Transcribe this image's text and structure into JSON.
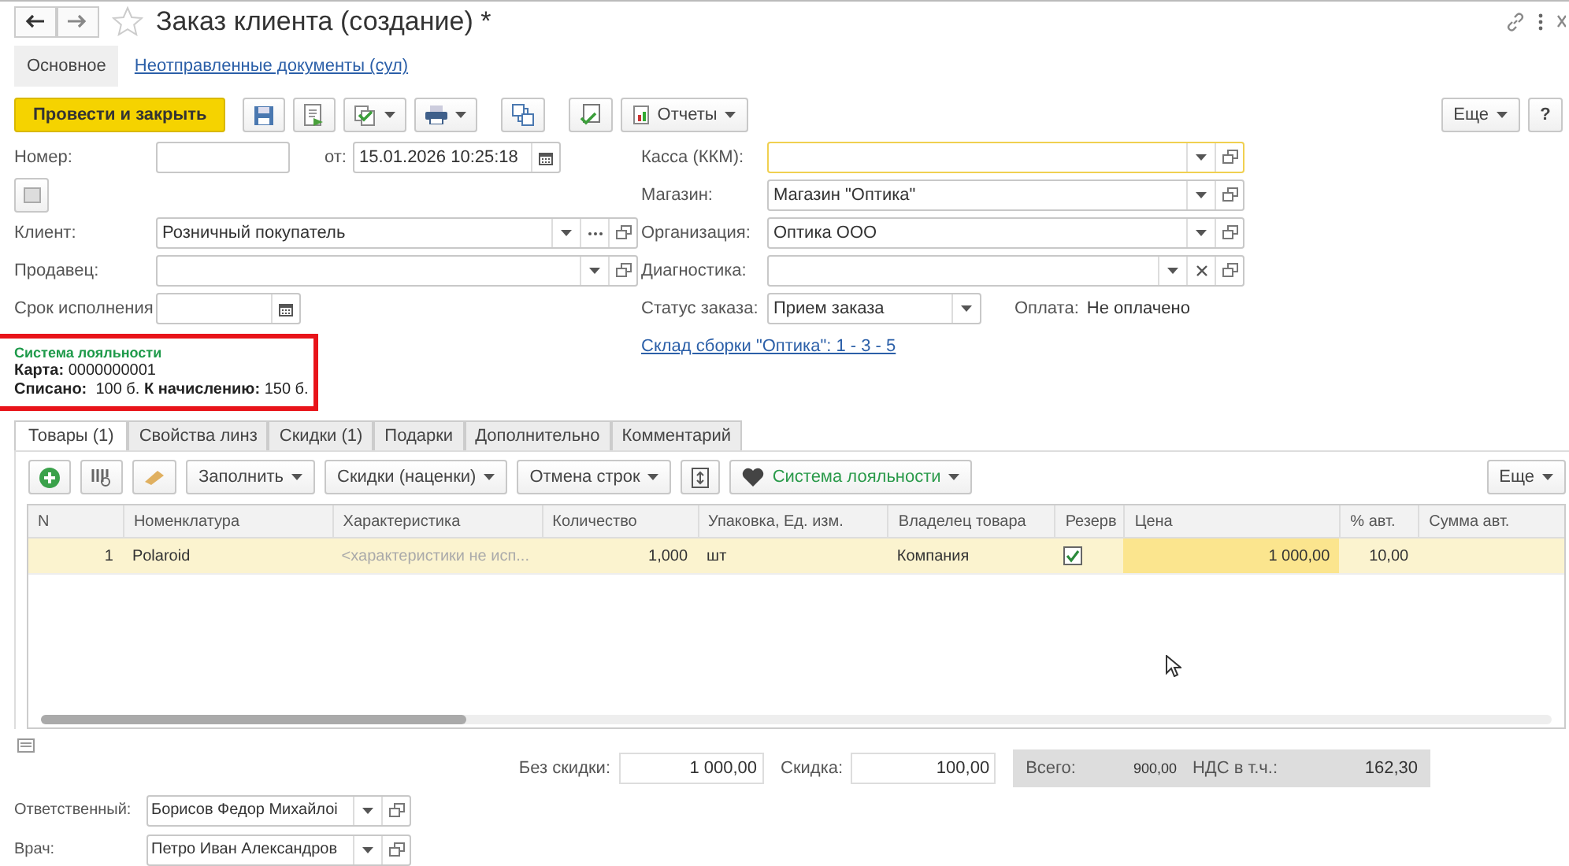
{
  "window": {
    "title": "Заказ клиента (создание) *",
    "favorite": false
  },
  "sections": [
    {
      "label": "Основное",
      "selected": true
    },
    {
      "label": "Неотправленные документы (сул)",
      "selected": false
    }
  ],
  "toolbar": {
    "primary": "Провести и закрыть",
    "reports": "Отчеты",
    "more": "Еще",
    "help": "?"
  },
  "left_fields": [
    {
      "label": "Номер:",
      "kind": "plain",
      "focused": false
    },
    {
      "label": "от:",
      "value": "15.01.2026 10:25:18",
      "kind": "date",
      "focused": false
    },
    {
      "label": "Клиент:",
      "value": "Розничный покупатель",
      "kind": "ref_select",
      "focused": false
    },
    {
      "label": "Продавец:",
      "kind": "ref",
      "focused": false
    },
    {
      "label": "Срок исполнения",
      "kind": "date",
      "focused": false
    }
  ],
  "right_fields": [
    {
      "label": "Касса (ККМ):",
      "kind": "ref",
      "focused": true
    },
    {
      "label": "Магазин:",
      "value": "Магазин \"Оптика\"",
      "kind": "ref",
      "focused": false
    },
    {
      "label": "Организация:",
      "value": "Оптика ООО",
      "kind": "ref",
      "focused": false
    },
    {
      "label": "Диагностика:",
      "kind": "ref_clear",
      "focused": false
    },
    {
      "label": "Статус заказа:",
      "value": "Прием заказа",
      "kind": "combo",
      "focused": false
    }
  ],
  "payment": {
    "label": "Оплата:",
    "value": "Не оплачено"
  },
  "warehouse_link": "Склад сборки \"Оптика\": 1 - 3 - 5",
  "loyalty": {
    "title": "Система лояльности",
    "lines": [
      "**Карта:** 0000000001",
      "**Списано:**  100 б. **К начислению:** 150 б."
    ]
  },
  "tabs": [
    {
      "label": "Товары (1)",
      "selected": true
    },
    {
      "label": "Свойства линз",
      "selected": false
    },
    {
      "label": "Скидки (1)",
      "selected": false
    },
    {
      "label": "Подарки",
      "selected": false
    },
    {
      "label": "Дополнительно",
      "selected": false
    },
    {
      "label": "Комментарий",
      "selected": false
    }
  ],
  "table_toolbar": {
    "fill": "Заполнить",
    "discounts": "Скидки (наценки)",
    "cancel": "Отмена строк",
    "loyalty": "Система лояльности",
    "more": "Еще"
  },
  "table": {
    "columns": [
      "N",
      "Номенклатура",
      "Характеристика",
      "Количество",
      "Упаковка, Ед. изм.",
      "Владелец товара",
      "Резерв",
      "Цена",
      "% авт.",
      "Сумма авт."
    ],
    "rows": [
      {
        "selected": true,
        "cells": [
          "1",
          "Polaroid",
          "<характеристики не исп...",
          "1,000",
          "шт",
          "Компания",
          "",
          "1 000,00",
          "10,00",
          ""
        ],
        "reserve": true
      }
    ]
  },
  "totals": {
    "no_discount_label": "Без скидки:",
    "no_discount": "1 000,00",
    "discount_label": "Скидка:",
    "discount": "100,00",
    "total_label": "Всего:",
    "total": "900,00",
    "vat_label": "НДС в т.ч.:",
    "vat": "162,30"
  },
  "bottom_fields": [
    {
      "label": "Ответственный:",
      "value": "Борисов Федор Михайлоі"
    },
    {
      "label": "Врач:",
      "value": "Петро Иван Александров"
    }
  ]
}
